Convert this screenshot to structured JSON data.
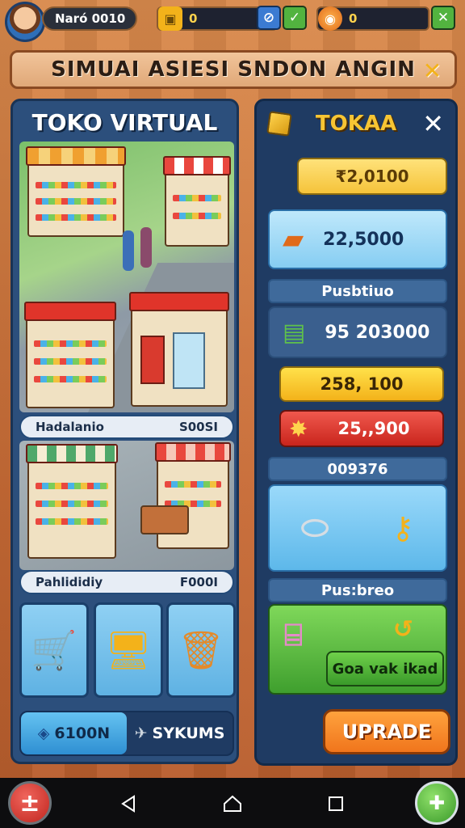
{
  "player": {
    "name": "Naró 0010"
  },
  "resources": [
    {
      "icon": "briefcase-icon",
      "value": "0"
    },
    {
      "icon": "globe-icon",
      "value": "0"
    }
  ],
  "banner": {
    "title": "SIMUAI ASIESI SNDON ANGIN"
  },
  "left_panel": {
    "title": "TOKO VIRTUAL",
    "info_rows": [
      {
        "label": "Hadalanio",
        "value": "S00SI"
      },
      {
        "label": "Pahlididiy",
        "value": "F000I"
      }
    ],
    "tiles": [
      {
        "icon": "shopping-cart-icon"
      },
      {
        "icon": "monitor-icon"
      },
      {
        "icon": "trash-bin-icon"
      }
    ],
    "tabs": [
      {
        "label": "6100N",
        "icon": "leaf-icon",
        "active": true
      },
      {
        "label": "SYKUMS",
        "icon": "rocket-icon",
        "active": false
      }
    ]
  },
  "right_panel": {
    "title": "TOKAA",
    "price_top": "₹2,0100",
    "item_price": "22,5000",
    "section_1": "Pusbtiuo",
    "item_price_2": "95 203000",
    "yellow_value": "258, 100",
    "red_value": "25,,900",
    "section_2": "009376",
    "section_3": "Pus:breo",
    "green_button": "Goa vak ikad",
    "upgrade": "UPRADE"
  },
  "colors": {
    "accent_gold": "#f7c533",
    "panel_blue": "#2c4f7c",
    "upgrade_orange": "#f0751c",
    "green": "#4ca83a",
    "red": "#d93a2e"
  }
}
